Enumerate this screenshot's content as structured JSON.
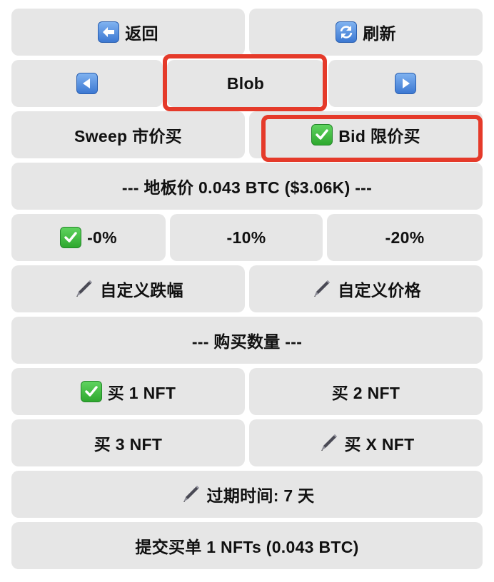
{
  "buttons": {
    "back": "返回",
    "refresh": "刷新",
    "prev": "",
    "current": "Blob",
    "next": "",
    "sweep": "Sweep 市价买",
    "bid": "Bid 限价买",
    "floor": "--- 地板价 0.043 BTC ($3.06K) ---",
    "pct0": "-0%",
    "pct10": "-10%",
    "pct20": "-20%",
    "custom_drop": "自定义跌幅",
    "custom_price": "自定义价格",
    "qty_header": "--- 购买数量 ---",
    "buy1": "买 1 NFT",
    "buy2": "买 2 NFT",
    "buy3": "买 3 NFT",
    "buyx": "买 X NFT",
    "expiry": "过期时间: 7 天",
    "submit": "提交买单 1 NFTs (0.043 BTC)"
  },
  "icons": {
    "back": "left-arrow-icon",
    "refresh": "refresh-icon",
    "prev": "left-triangle-icon",
    "next": "right-triangle-icon",
    "check": "check-mark-icon",
    "pen": "pen-icon"
  },
  "colors": {
    "button_bg": "#e6e6e6",
    "highlight": "#e53a2a",
    "check_green": "#2ea82e",
    "icon_blue": "#3c78d2"
  }
}
